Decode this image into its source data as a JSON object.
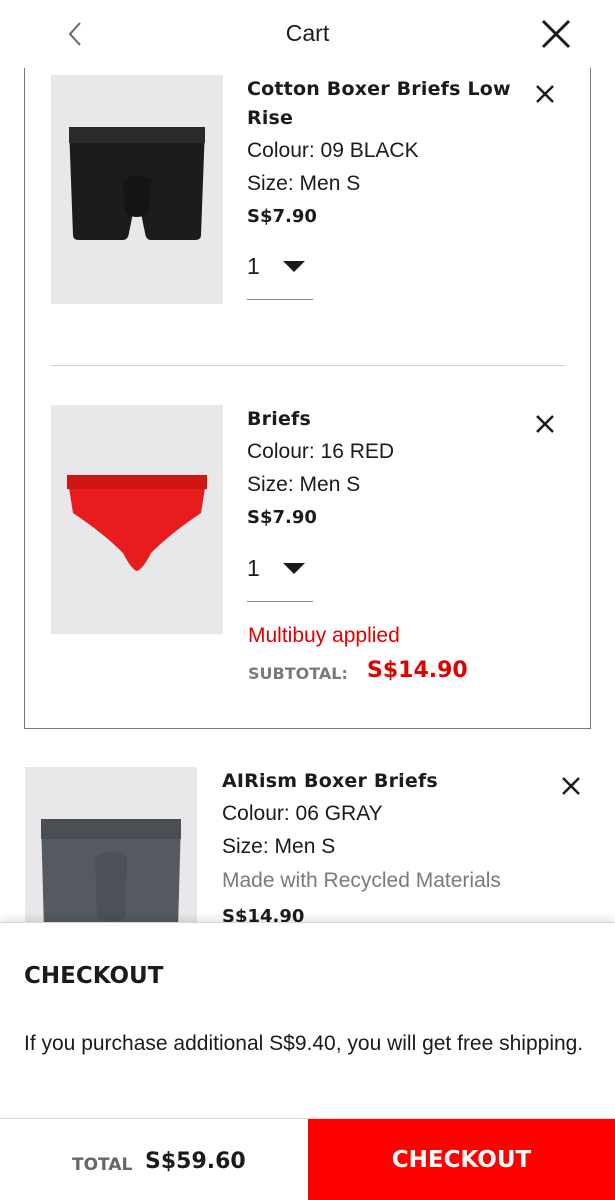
{
  "header": {
    "title": "Cart",
    "back_icon": "chevron-left-icon",
    "close_icon": "close-icon"
  },
  "multibuy_group": {
    "items": [
      {
        "name": "Cotton Boxer Briefs Low Rise",
        "colour": "Colour: 09 BLACK",
        "size": "Size: Men S",
        "price": "S$7.90",
        "quantity": "1",
        "product_color": "#1c1c1c"
      },
      {
        "name": "Briefs",
        "colour": "Colour: 16 RED",
        "size": "Size: Men S",
        "price": "S$7.90",
        "quantity": "1",
        "product_color": "#e81c1c"
      }
    ],
    "multibuy_label": "Multibuy applied",
    "subtotal_label": "SUBTOTAL:",
    "subtotal_value": "S$14.90"
  },
  "standalone_item": {
    "name": "AIRism Boxer Briefs",
    "colour": "Colour: 06 GRAY",
    "size": "Size: Men S",
    "note": "Made with Recycled Materials",
    "price": "S$14.90",
    "product_color": "#555a61"
  },
  "checkout_panel": {
    "heading": "CHECKOUT",
    "shipping_note": "If you purchase additional S$9.40, you will get free shipping."
  },
  "footer": {
    "total_label": "TOTAL",
    "total_value": "S$59.60",
    "checkout_button": "CHECKOUT"
  },
  "colors": {
    "accent": "#ff0000",
    "sale_text": "#e00000",
    "text": "#1b1b1b",
    "thumb_bg": "#e8e8ea"
  }
}
